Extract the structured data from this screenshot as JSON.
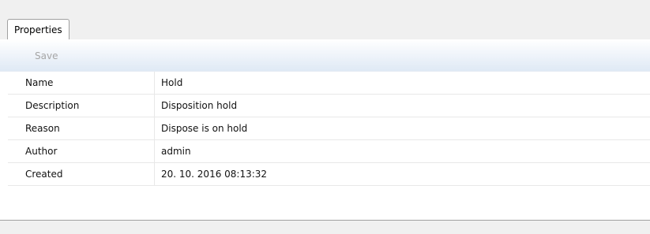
{
  "tabs": [
    {
      "label": "Properties"
    }
  ],
  "toolbar": {
    "save_label": "Save"
  },
  "properties": [
    {
      "name": "Name",
      "value": "Hold"
    },
    {
      "name": "Description",
      "value": "Disposition hold"
    },
    {
      "name": "Reason",
      "value": "Dispose is on hold"
    },
    {
      "name": "Author",
      "value": "admin"
    },
    {
      "name": "Created",
      "value": "20. 10. 2016 08:13:32"
    }
  ]
}
